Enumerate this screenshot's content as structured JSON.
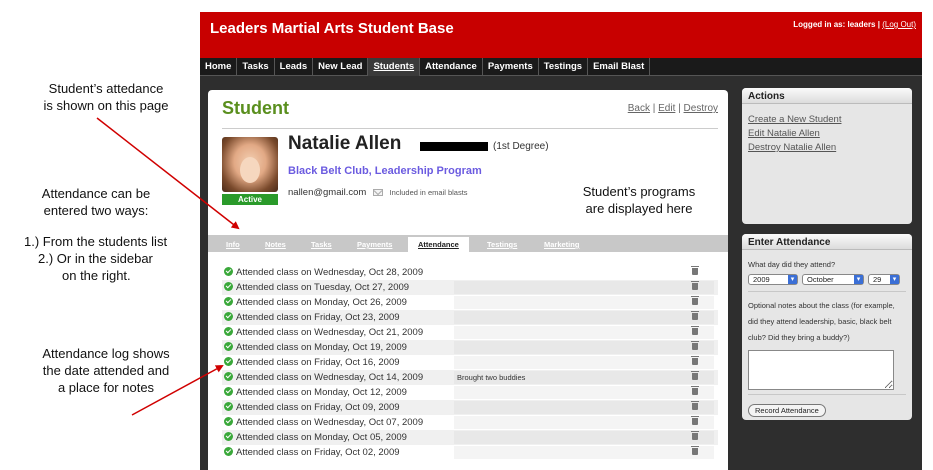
{
  "annotations": {
    "a1": [
      "Student’s attedance",
      "is shown on this page"
    ],
    "a2": [
      "Attendance can be",
      "entered two ways:"
    ],
    "a3": [
      "1.)  From the students list",
      "2.)  Or in the sidebar",
      "on the right."
    ],
    "a4": [
      "Attendance log shows",
      "the date attended and",
      "a place for notes"
    ],
    "a5": [
      "Student’s programs",
      "are displayed here"
    ]
  },
  "header": {
    "title": "Leaders Martial Arts Student Base",
    "logged_in": "Logged in as: leaders |",
    "logout": "(Log Out)"
  },
  "nav": [
    "Home",
    "Tasks",
    "Leads",
    "New Lead",
    "Students",
    "Attendance",
    "Payments",
    "Testings",
    "Email Blast"
  ],
  "main": {
    "title": "Student",
    "links": {
      "back": "Back",
      "edit": "Edit",
      "destroy": "Destroy"
    },
    "student": {
      "name": "Natalie Allen",
      "degree": "(1st Degree)",
      "programs": "Black Belt Club, Leadership Program",
      "email": "nallen@gmail.com",
      "email_note": "Included in email blasts",
      "status": "Active"
    },
    "tabs": [
      "Info",
      "Notes",
      "Tasks",
      "Payments",
      "Attendance",
      "Testings",
      "Marketing"
    ],
    "log": [
      {
        "text": "Attended class on Wednesday, Oct 28, 2009",
        "note": ""
      },
      {
        "text": "Attended class on Tuesday, Oct 27, 2009",
        "note": ""
      },
      {
        "text": "Attended class on Monday, Oct 26, 2009",
        "note": ""
      },
      {
        "text": "Attended class on Friday, Oct 23, 2009",
        "note": ""
      },
      {
        "text": "Attended class on Wednesday, Oct 21, 2009",
        "note": ""
      },
      {
        "text": "Attended class on Monday, Oct 19, 2009",
        "note": ""
      },
      {
        "text": "Attended class on Friday, Oct 16, 2009",
        "note": ""
      },
      {
        "text": "Attended class on Wednesday, Oct 14, 2009",
        "note": "Brought two buddies"
      },
      {
        "text": "Attended class on Monday, Oct 12, 2009",
        "note": ""
      },
      {
        "text": "Attended class on Friday, Oct 09, 2009",
        "note": ""
      },
      {
        "text": "Attended class on Wednesday, Oct 07, 2009",
        "note": ""
      },
      {
        "text": "Attended class on Monday, Oct 05, 2009",
        "note": ""
      },
      {
        "text": "Attended class on Friday, Oct 02, 2009",
        "note": ""
      }
    ]
  },
  "sidebar": {
    "actions_title": "Actions",
    "actions": [
      "Create a New Student",
      "Edit Natalie Allen",
      "Destroy Natalie Allen"
    ],
    "enter_title": "Enter Attendance",
    "day_label": "What day did they attend?",
    "year": "2009",
    "month": "October",
    "day": "29",
    "notes_label": "Optional notes about the class (for example, did they attend leadership, basic, black belt club? Did they bring a buddy?)",
    "record_button": "Record Attendance"
  },
  "colors": {
    "header_red": "#c80000",
    "title_green": "#5a8f1e",
    "program_purple": "#6b5be0",
    "active_green": "#2a9a2a",
    "arrow_red": "#d00000"
  }
}
